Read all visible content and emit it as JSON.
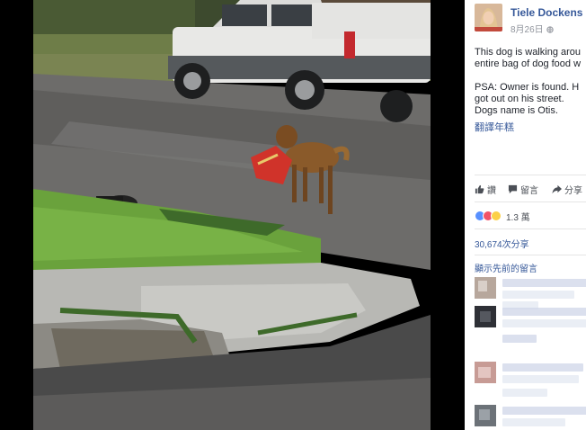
{
  "post": {
    "author": "Tiele Dockens",
    "date": "8月26日",
    "privacy_glyph": "·",
    "text_lines": [
      "This dog is walking arou",
      "entire bag of dog food w"
    ],
    "psa_lines": [
      "PSA: Owner is found. H",
      "got out on his street.",
      "Dogs name is Otis."
    ],
    "see_translation": "翻譯年糕"
  },
  "actions": {
    "like": "讚",
    "comment": "留言",
    "share": "分享"
  },
  "reactions": {
    "icons": [
      "like-reaction",
      "love-reaction",
      "haha-reaction"
    ],
    "count": "1.3 萬"
  },
  "shares": "30,674次分享",
  "view_previous_comments": "顯示先前的留言",
  "colors": {
    "link": "#365899",
    "like_reaction": "#5890ff",
    "love_reaction": "#f25268",
    "haha_reaction": "#fcd047"
  }
}
